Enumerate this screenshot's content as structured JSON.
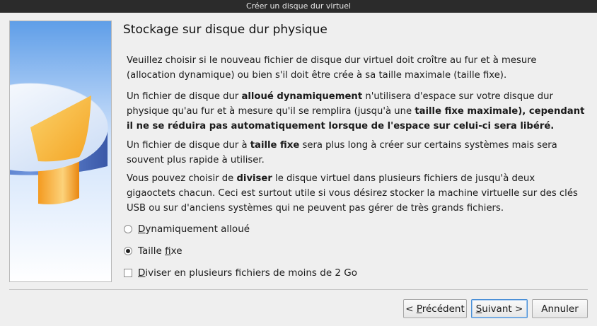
{
  "window": {
    "title": "Créer un disque dur virtuel"
  },
  "page": {
    "heading": "Stockage sur disque dur physique",
    "paragraphs": [
      {
        "parts": [
          {
            "text": "Veuillez choisir si le nouveau fichier de disque dur virtuel doit croître au fur et à mesure (allocation dynamique) ou bien s'il doit être crée à sa taille maximale (taille fixe).",
            "bold": false
          }
        ]
      },
      {
        "parts": [
          {
            "text": "Un fichier de disque dur ",
            "bold": false
          },
          {
            "text": "alloué dynamiquement",
            "bold": true
          },
          {
            "text": " n'utilisera d'espace sur votre disque dur physique qu'au fur et à mesure qu'il se remplira (jusqu'à une ",
            "bold": false
          },
          {
            "text": "taille fixe maximale), cependant il ne se réduira pas automatiquement lorsque de l'espace sur celui-ci sera libéré.",
            "bold": true
          }
        ]
      },
      {
        "parts": [
          {
            "text": "Un fichier de disque dur à ",
            "bold": false
          },
          {
            "text": "taille fixe",
            "bold": true
          },
          {
            "text": " sera plus long à créer sur certains systèmes mais sera souvent plus rapide à utiliser.",
            "bold": false
          }
        ]
      },
      {
        "parts": [
          {
            "text": "Vous pouvez choisir de ",
            "bold": false
          },
          {
            "text": "diviser",
            "bold": true
          },
          {
            "text": " le disque virtuel dans plusieurs fichiers de jusqu'à deux gigaoctets chacun. Ceci est surtout utile si vous désirez stocker la machine virtuelle sur des clés USB ou sur d'anciens systèmes qui ne peuvent pas gérer de très grands fichiers.",
            "bold": false
          }
        ]
      }
    ],
    "options": {
      "dynamic": {
        "mnemonic": "D",
        "rest": "ynamiquement alloué",
        "selected": false
      },
      "fixed": {
        "pre": "Taille ",
        "mnemonic": "f",
        "rest": "ixe",
        "selected": true
      },
      "split": {
        "mnemonic": "D",
        "rest": "iviser en plusieurs fichiers de moins de 2 Go",
        "checked": false
      }
    }
  },
  "buttons": {
    "back": {
      "pre": "< ",
      "mnemonic": "P",
      "rest": "récédent"
    },
    "next": {
      "pre": "",
      "mnemonic": "S",
      "rest": "uivant >"
    },
    "cancel": {
      "label": "Annuler"
    }
  }
}
